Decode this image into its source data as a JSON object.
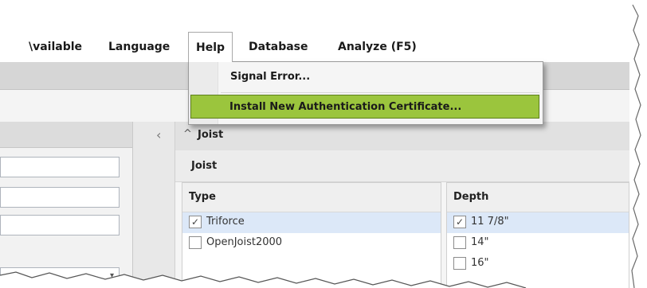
{
  "menubar": {
    "items": [
      {
        "label": "\\vailable"
      },
      {
        "label": "Language"
      },
      {
        "label": "Help"
      },
      {
        "label": "Database"
      },
      {
        "label": "Analyze (F5)"
      }
    ]
  },
  "help_menu": {
    "items": [
      {
        "label": "Signal Error..."
      },
      {
        "label": "Install New Authentication Certificate...",
        "highlighted": true
      }
    ],
    "highlight_color": "#9bc53d"
  },
  "section": {
    "title": "Joist",
    "group_title": "Joist",
    "type_column": {
      "header": "Type",
      "options": [
        {
          "label": "Triforce",
          "checked": true
        },
        {
          "label": "OpenJoist2000",
          "checked": false
        }
      ]
    },
    "depth_column": {
      "header": "Depth",
      "options": [
        {
          "label": "11 7/8\"",
          "checked": true
        },
        {
          "label": "14\"",
          "checked": false
        },
        {
          "label": "16\"",
          "checked": false
        }
      ]
    }
  },
  "icons": {
    "collapse_panel": "chevron-left-icon",
    "section_toggle": "chevron-up-icon",
    "dropdown_arrow": "chevron-down-icon",
    "checkmark": "checkmark-icon"
  }
}
